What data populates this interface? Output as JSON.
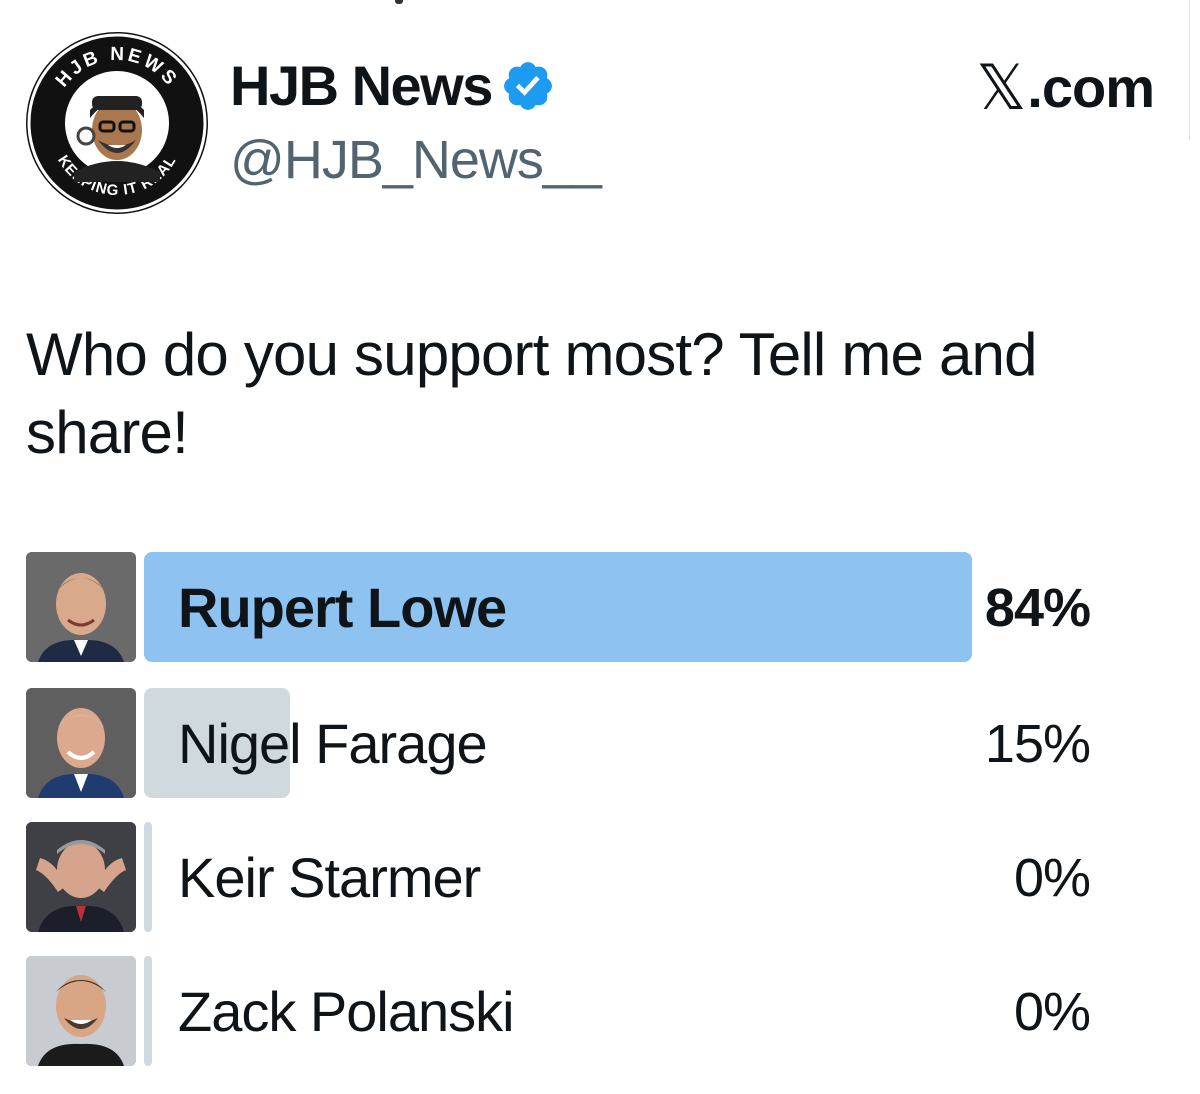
{
  "account": {
    "display_name": "HJB News",
    "handle": "@HJB_News__",
    "verified_icon": "verified-badge-icon",
    "avatar_text_top": "HJB NEWS",
    "avatar_text_bottom": "KEEPING IT REAL"
  },
  "brand": {
    "glyph": "𝕏",
    "label": ".com"
  },
  "post": {
    "text": "Who do you support most? Tell me and share!"
  },
  "poll": {
    "options": [
      {
        "label": "Rupert Lowe",
        "percent_text": "84%",
        "percent": 84,
        "leading": true
      },
      {
        "label": "Nigel Farage",
        "percent_text": "15%",
        "percent": 15,
        "leading": false
      },
      {
        "label": "Keir Starmer",
        "percent_text": "0%",
        "percent": 0,
        "leading": false
      },
      {
        "label": "Zack Polanski",
        "percent_text": "0%",
        "percent": 0,
        "leading": false
      }
    ]
  },
  "colors": {
    "leading_bar": "#8ec2f0",
    "other_bar": "#cfd9de",
    "verified": "#1d9bf0",
    "handle": "#536471",
    "text": "#0f1419"
  }
}
